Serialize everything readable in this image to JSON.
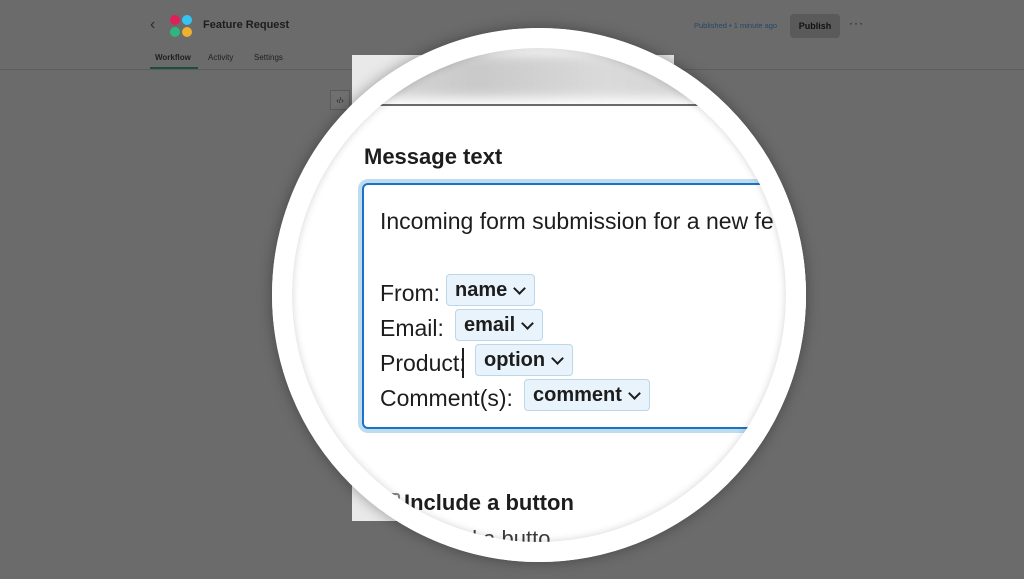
{
  "header": {
    "back_glyph": "‹",
    "title": "Feature Request",
    "published_status": "Published • 1 minute ago",
    "publish_label": "Publish",
    "more_glyph": "···"
  },
  "tabs": [
    {
      "label": "Workflow",
      "active": true
    },
    {
      "label": "Activity",
      "active": false
    },
    {
      "label": "Settings",
      "active": false
    }
  ],
  "toolbar": {
    "code_glyph": "‹/›"
  },
  "editor": {
    "section_label": "Message text",
    "intro_line": "Incoming form submission for a new fe",
    "fields": [
      {
        "label": "From:",
        "token": "name"
      },
      {
        "label": "Email:",
        "token": "email"
      },
      {
        "label": "Product:",
        "token": "option"
      },
      {
        "label": "Comment(s):",
        "token": "comment"
      }
    ],
    "include_button_label": "Include a button",
    "add_button_text": "n add a butto"
  },
  "colors": {
    "accent": "#1a73c8",
    "token_bg": "#e8f3fb",
    "overlay": "#6b6b6b"
  }
}
